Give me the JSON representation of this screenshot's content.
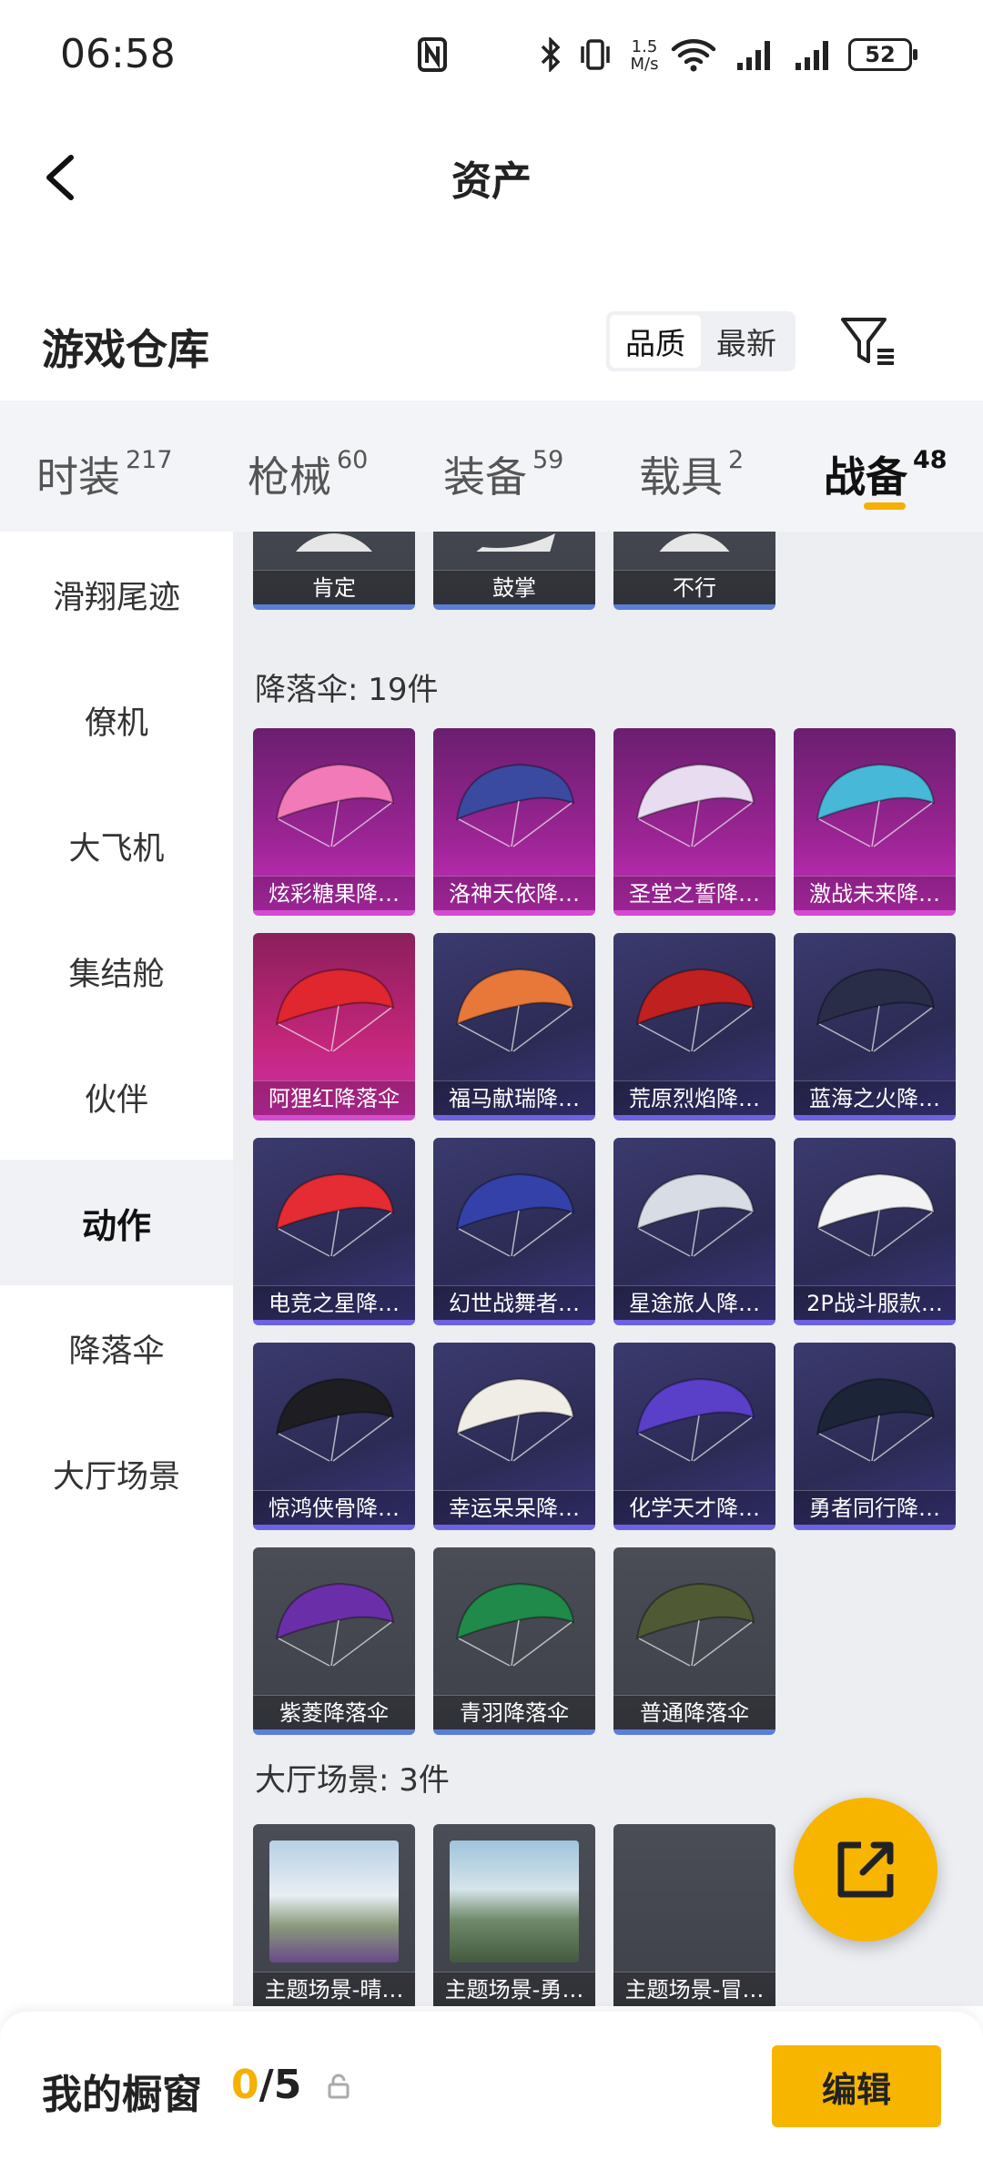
{
  "status": {
    "time": "06:58",
    "speed": "1.5\nM/s",
    "speed_top": "1.5",
    "speed_bottom": "M/s",
    "battery": "52"
  },
  "header": {
    "title": "资产"
  },
  "section": {
    "title": "游戏仓库",
    "sort_options": [
      "品质",
      "最新"
    ],
    "sort_active": 0
  },
  "tabs": [
    {
      "label": "时装",
      "count": "217"
    },
    {
      "label": "枪械",
      "count": "60"
    },
    {
      "label": "装备",
      "count": "59"
    },
    {
      "label": "载具",
      "count": "2"
    },
    {
      "label": "战备",
      "count": "48"
    }
  ],
  "tab_active": 4,
  "sidebar": {
    "items": [
      "滑翔尾迹",
      "僚机",
      "大飞机",
      "集结舱",
      "伙伴",
      "动作",
      "降落伞",
      "大厅场景"
    ],
    "active": 5
  },
  "groups": {
    "actions": {
      "items": [
        "肯定",
        "鼓掌",
        "不行"
      ]
    },
    "parachutes": {
      "label": "降落伞: 19件",
      "items": [
        {
          "name": "炫彩糖果降…",
          "tier": "pink",
          "color": "#f37ab8"
        },
        {
          "name": "洛神天依降…",
          "tier": "pink",
          "color": "#3a4aa0"
        },
        {
          "name": "圣堂之誓降…",
          "tier": "pink",
          "color": "#e8ddf0"
        },
        {
          "name": "激战未来降…",
          "tier": "pink",
          "color": "#47b8d8"
        },
        {
          "name": "阿狸红降落伞",
          "tier": "pinkred",
          "color": "#e0262e"
        },
        {
          "name": "福马献瑞降…",
          "tier": "purple",
          "color": "#e8783a"
        },
        {
          "name": "荒原烈焰降…",
          "tier": "purple",
          "color": "#c02020"
        },
        {
          "name": "蓝海之火降…",
          "tier": "purple",
          "color": "#2a2d48"
        },
        {
          "name": "电竞之星降…",
          "tier": "purple",
          "color": "#e52b34"
        },
        {
          "name": "幻世战舞者…",
          "tier": "purple",
          "color": "#3441a8"
        },
        {
          "name": "星途旅人降…",
          "tier": "purple",
          "color": "#d8dce4"
        },
        {
          "name": "2P战斗服款…",
          "tier": "purple",
          "color": "#f2f2f4"
        },
        {
          "name": "惊鸿侠骨降…",
          "tier": "purple",
          "color": "#1e1e22"
        },
        {
          "name": "幸运呆呆降…",
          "tier": "purple",
          "color": "#f0ede6"
        },
        {
          "name": "化学天才降…",
          "tier": "purple",
          "color": "#5a3fc8"
        },
        {
          "name": "勇者同行降…",
          "tier": "purple",
          "color": "#1c2438"
        },
        {
          "name": "紫菱降落伞",
          "tier": "grey",
          "color": "#6a2fa8"
        },
        {
          "name": "青羽降落伞",
          "tier": "grey",
          "color": "#1f8a4a"
        },
        {
          "name": "普通降落伞",
          "tier": "grey",
          "color": "#4f5a34"
        }
      ]
    },
    "scenes": {
      "label": "大厅场景: 3件",
      "items": [
        {
          "name": "主题场景-晴…"
        },
        {
          "name": "主题场景-勇…"
        },
        {
          "name": "主题场景-冒…"
        }
      ]
    }
  },
  "bottom": {
    "window_label": "我的橱窗",
    "count_current": "0",
    "count_total": "/5",
    "edit_label": "编辑"
  },
  "colors": {
    "accent": "#f7b500"
  }
}
